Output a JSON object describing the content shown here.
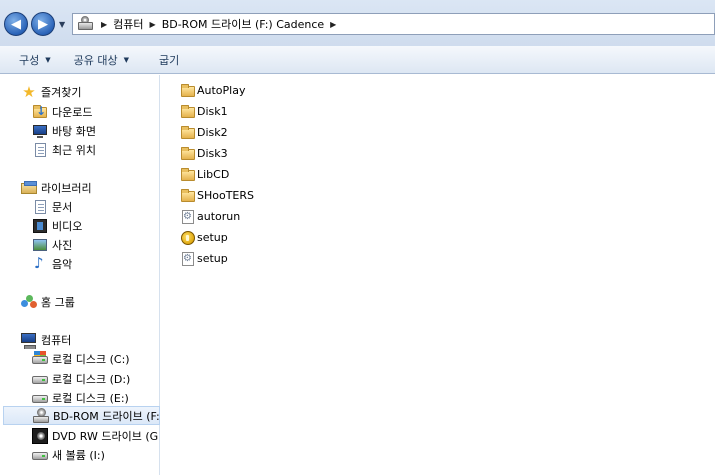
{
  "address": {
    "crumbs": [
      "컴퓨터",
      "BD-ROM 드라이브 (F:) Cadence"
    ]
  },
  "toolbar": {
    "organize": "구성",
    "share": "공유 대상",
    "burn": "굽기"
  },
  "nav": {
    "favorites": {
      "label": "즐겨찾기",
      "items": [
        "다운로드",
        "바탕 화면",
        "최근 위치"
      ]
    },
    "libraries": {
      "label": "라이브러리",
      "items": [
        "문서",
        "비디오",
        "사진",
        "음악"
      ]
    },
    "homegroup": {
      "label": "홈 그룹"
    },
    "computer": {
      "label": "컴퓨터",
      "items": [
        "로컬 디스크 (C:)",
        "로컬 디스크 (D:)",
        "로컬 디스크 (E:)",
        "BD-ROM 드라이브 (F:)",
        "DVD RW 드라이브 (G",
        "새 볼륨 (I:)"
      ]
    }
  },
  "files": [
    {
      "name": "AutoPlay",
      "type": "folder"
    },
    {
      "name": "Disk1",
      "type": "folder"
    },
    {
      "name": "Disk2",
      "type": "folder"
    },
    {
      "name": "Disk3",
      "type": "folder"
    },
    {
      "name": "LibCD",
      "type": "folder"
    },
    {
      "name": "SHooTERS",
      "type": "folder"
    },
    {
      "name": "autorun",
      "type": "inf"
    },
    {
      "name": "setup",
      "type": "exe"
    },
    {
      "name": "setup",
      "type": "inf"
    }
  ]
}
